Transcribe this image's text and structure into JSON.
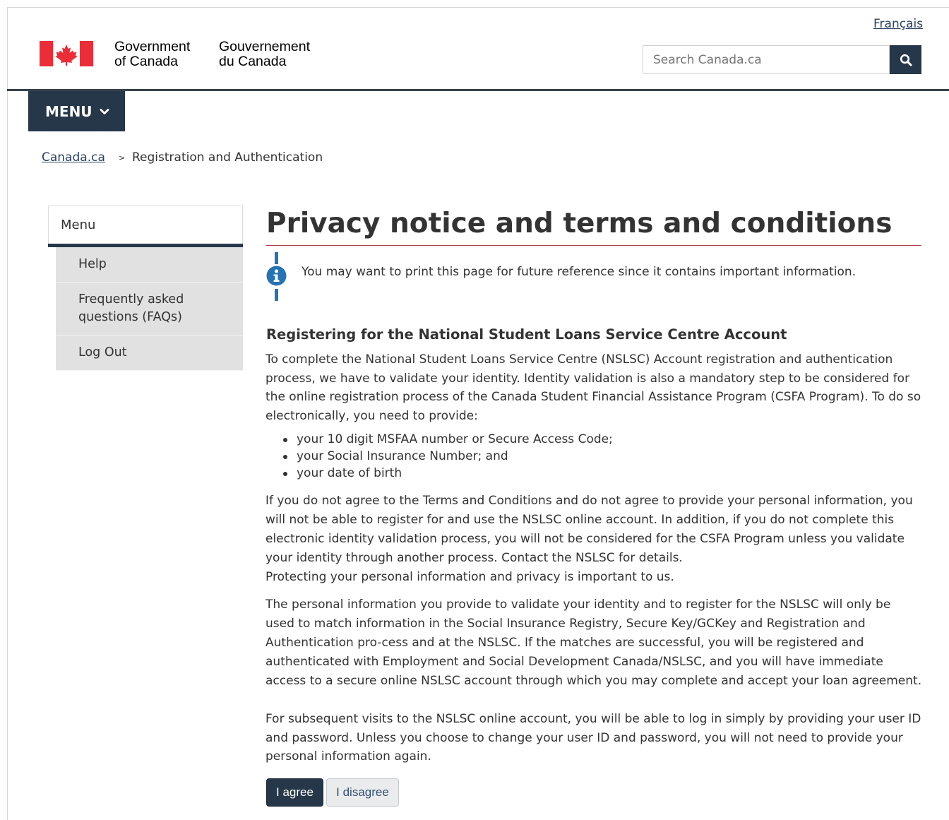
{
  "header": {
    "language_link": "Français",
    "signature_en_line1": "Government",
    "signature_en_line2": "of Canada",
    "signature_fr_line1": "Gouvernement",
    "signature_fr_line2": "du Canada",
    "search_placeholder": "Search Canada.ca",
    "menu_label": "MENU"
  },
  "breadcrumb": {
    "home": "Canada.ca",
    "separator": ">",
    "current": "Registration and Authentication"
  },
  "side_menu": {
    "heading": "Menu",
    "items": [
      {
        "line1": "Help",
        "line2": ""
      },
      {
        "line1": "Frequently asked",
        "line2": "questions (FAQs)"
      },
      {
        "line1": "Log Out",
        "line2": ""
      }
    ]
  },
  "main": {
    "title": "Privacy notice and terms and conditions",
    "info_text": "You may want to print this page for future reference since it contains important information.",
    "section_heading": "Registering for the National Student Loans Service Centre Account",
    "paragraph1": "To complete the National Student Loans Service Centre (NSLSC) Account registration and authentication process, we have to validate your identity. Identity validation is also a mandatory step to be considered for the online registration process of the Canada Student Financial Assistance Program (CSFA Program). To do so electronically, you need to provide:",
    "bullets": [
      "your 10 digit MSFAA number or Secure Access Code;",
      "your Social Insurance Number; and",
      "your date of birth"
    ],
    "paragraph2": "If you do not agree to the Terms and Conditions and do not agree to provide your personal information, you will not be able to register for and use the NSLSC online account. In addition, if you do not complete this electronic identity validation process, you will not be considered for the CSFA Program unless you validate your identity through another process. Contact the NSLSC for details.",
    "paragraph3": "Protecting your personal information and privacy is important to us.",
    "paragraph4": "The personal information you provide to validate your identity and to register for the NSLSC will only be used to match information in the Social Insurance Registry, Secure Key/GCKey and Registration and Authentication pro-cess and at the NSLSC. If the matches are successful, you will be registered and authenticated with Employment and Social Development Canada/NSLSC, and you will have immediate access to a secure online NSLSC account through which you may complete and accept your loan agreement.",
    "paragraph5": "For subsequent visits to the NSLSC online account, you will be able to log in simply by providing your user ID and password. Unless you choose to change your user ID and password, you will not need to provide your personal information again.",
    "agree_label": "I agree",
    "disagree_label": "I disagree"
  },
  "colors": {
    "brand_dark": "#26374a",
    "flag_red": "#eb2d37",
    "info_blue": "#2572b4",
    "title_rule": "#af3c43",
    "link": "#284162"
  },
  "icons": [
    "canada-flag-icon",
    "search-icon",
    "chevron-down-icon",
    "info-icon"
  ]
}
